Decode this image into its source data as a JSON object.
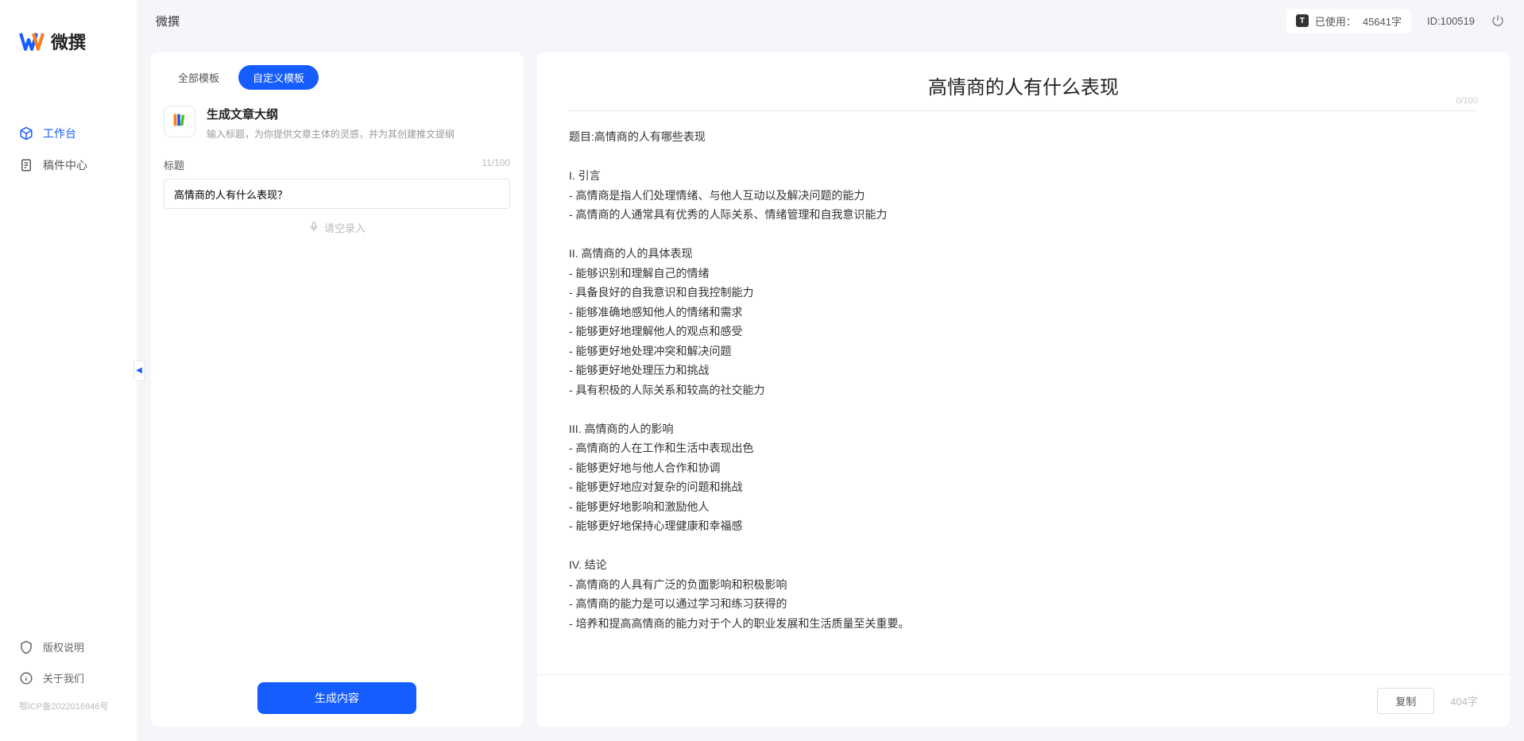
{
  "app": {
    "name": "微撰"
  },
  "sidebar": {
    "nav": [
      {
        "label": "工作台",
        "icon": "cube"
      },
      {
        "label": "稿件中心",
        "icon": "doc"
      }
    ],
    "bottom": [
      {
        "label": "版权说明",
        "icon": "shield"
      },
      {
        "label": "关于我们",
        "icon": "info"
      }
    ],
    "icp": "鄂ICP备2022016946号"
  },
  "topbar": {
    "title": "微撰",
    "usage_label": "已使用：",
    "usage_value": "45641字",
    "id_label": "ID:100519",
    "badge_glyph": "T"
  },
  "tabs": [
    {
      "label": "全部模板",
      "active": false
    },
    {
      "label": "自定义模板",
      "active": true
    }
  ],
  "template": {
    "title": "生成文章大纲",
    "desc": "输入标题，为你提供文章主体的灵感，并为其创建推文提纲"
  },
  "form": {
    "title_label": "标题",
    "title_count": "11/100",
    "title_value": "高情商的人有什么表现？",
    "voice_label": "请空录入"
  },
  "generate_button": "生成内容",
  "result": {
    "title": "高情商的人有什么表现",
    "header_count": "0/100",
    "body": "题目:高情商的人有哪些表现\n\nI. 引言\n- 高情商是指人们处理情绪、与他人互动以及解决问题的能力\n- 高情商的人通常具有优秀的人际关系、情绪管理和自我意识能力\n\nII. 高情商的人的具体表现\n- 能够识别和理解自己的情绪\n- 具备良好的自我意识和自我控制能力\n- 能够准确地感知他人的情绪和需求\n- 能够更好地理解他人的观点和感受\n- 能够更好地处理冲突和解决问题\n- 能够更好地处理压力和挑战\n- 具有积极的人际关系和较高的社交能力\n\nIII. 高情商的人的影响\n- 高情商的人在工作和生活中表现出色\n- 能够更好地与他人合作和协调\n- 能够更好地应对复杂的问题和挑战\n- 能够更好地影响和激励他人\n- 能够更好地保持心理健康和幸福感\n\nIV. 结论\n- 高情商的人具有广泛的负面影响和积极影响\n- 高情商的能力是可以通过学习和练习获得的\n- 培养和提高高情商的能力对于个人的职业发展和生活质量至关重要。",
    "copy_label": "复制",
    "char_count": "404字"
  }
}
